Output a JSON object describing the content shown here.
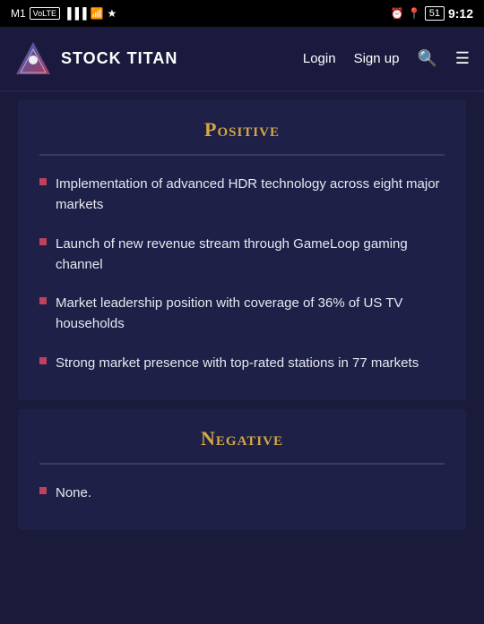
{
  "statusBar": {
    "carrier": "M1",
    "volte": "VoLTE",
    "time": "9:12",
    "battery": "51"
  },
  "navbar": {
    "logoText": "STOCK TITAN",
    "loginLabel": "Login",
    "signupLabel": "Sign up"
  },
  "positiveSection": {
    "title": "Positive",
    "items": [
      "Implementation of advanced HDR technology across eight major markets",
      "Launch of new revenue stream through GameLoop gaming channel",
      "Market leadership position with coverage of 36% of US TV households",
      "Strong market presence with top-rated stations in 77 markets"
    ]
  },
  "negativeSection": {
    "title": "Negative",
    "items": [
      "None."
    ]
  }
}
